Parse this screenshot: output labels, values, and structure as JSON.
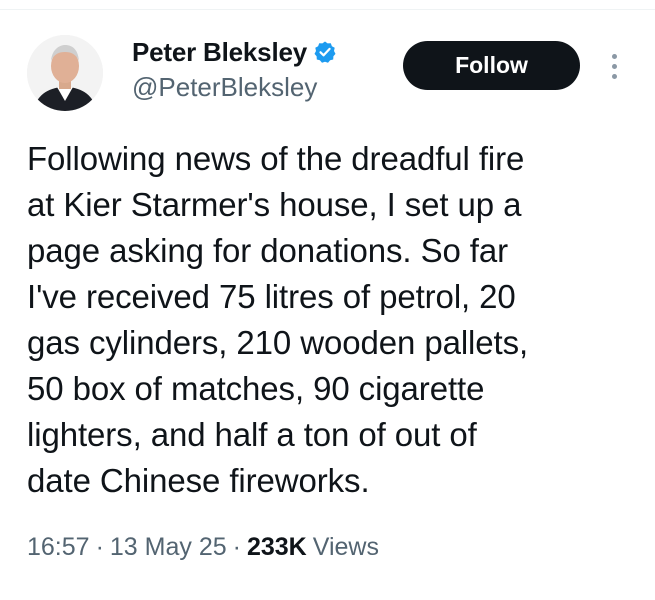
{
  "tweet": {
    "author": {
      "display_name": "Peter Bleksley",
      "handle": "@PeterBleksley",
      "verified": true,
      "verified_color": "#1d9bf0"
    },
    "follow_label": "Follow",
    "more_icon": "more-dots-icon",
    "text": "Following news of the dreadful fire\nat Kier Starmer's house, I set up a\npage asking for donations. So far\nI've received 75 litres of petrol, 20\ngas cylinders, 210 wooden pallets,\n50 box of matches, 90 cigarette\nlighters, and half a ton of out of\ndate Chinese fireworks.",
    "meta": {
      "time": "16:57",
      "separator": "·",
      "date": "13 May 25",
      "views_count": "233K",
      "views_label": "Views"
    }
  },
  "colors": {
    "text_primary": "#0f1419",
    "text_secondary": "#536471",
    "follow_bg": "#0f1419",
    "follow_text": "#ffffff"
  }
}
